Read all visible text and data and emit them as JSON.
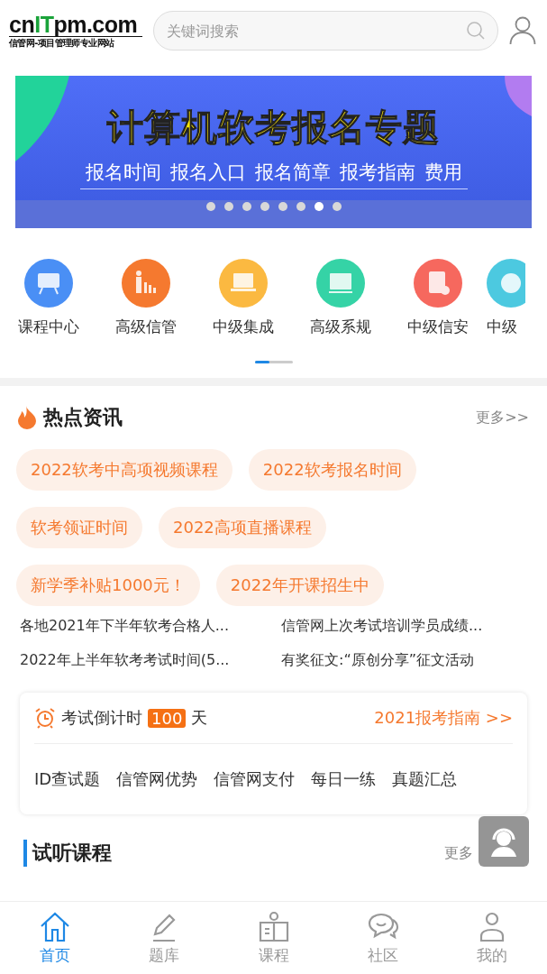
{
  "header": {
    "logo": [
      {
        "text": "cn",
        "highlight": false
      },
      {
        "text": "IT",
        "highlight": true
      },
      {
        "text": "pm.com",
        "highlight": false
      }
    ],
    "tagline": "信管网-项目管理师专业网站",
    "search": {
      "placeholder": "关键词搜索"
    }
  },
  "banner": {
    "title": "计算机软考报名专题",
    "links": [
      "报名时间",
      "报名入口",
      "报名简章",
      "报考指南",
      "费用"
    ],
    "dots": [
      {
        "selected": false
      },
      {
        "selected": false
      },
      {
        "selected": false
      },
      {
        "selected": false
      },
      {
        "selected": false
      },
      {
        "selected": false
      },
      {
        "selected": true
      },
      {
        "selected": false
      }
    ]
  },
  "categories": {
    "items": [
      {
        "label": "课程中心",
        "color": "#4a8ff5",
        "kind": "board"
      },
      {
        "label": "高级信管",
        "color": "#f5792f",
        "kind": "chart"
      },
      {
        "label": "中级集成",
        "color": "#fbb941",
        "kind": "laptop"
      },
      {
        "label": "高级系规",
        "color": "#35d3a6",
        "kind": "screen"
      },
      {
        "label": "中级信安",
        "color": "#f6685e",
        "kind": "doc"
      },
      {
        "label": "中级",
        "color": "#4cc9e0",
        "kind": "globe"
      }
    ]
  },
  "hot_news": {
    "title": "热点资讯",
    "more": "更多>>",
    "tags": [
      "2022软考中高项视频课程",
      "2022软考报名时间",
      "软考领证时间",
      "2022高项直播课程",
      "新学季补贴1000元！",
      "2022年开课招生中"
    ],
    "articles": [
      "各地2021年下半年软考合格人...",
      "信管网上次考试培训学员成绩...",
      "2022年上半年软考考试时间(5...",
      "有奖征文:“原创分享”征文活动"
    ]
  },
  "countdown": {
    "label": "考试倒计时",
    "days": "100",
    "unit": "天",
    "guide": "2021报考指南 >>",
    "links": [
      "ID查试题",
      "信管网优势",
      "信管网支付",
      "每日一练",
      "真题汇总"
    ]
  },
  "trial": {
    "title": "试听课程",
    "more": "更多"
  },
  "tabs": [
    {
      "label": "首页",
      "kind": "home",
      "selected": true
    },
    {
      "label": "题库",
      "kind": "pencil",
      "selected": false
    },
    {
      "label": "课程",
      "kind": "book",
      "selected": false
    },
    {
      "label": "社区",
      "kind": "chat",
      "selected": false
    },
    {
      "label": "我的",
      "kind": "person",
      "selected": false
    }
  ]
}
